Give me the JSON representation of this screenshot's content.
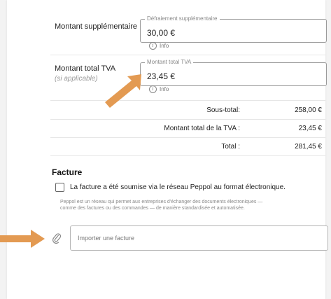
{
  "supplement": {
    "label": "Montant supplémentaire",
    "legend": "Défraiement supplémentaire",
    "value": "30,00 €",
    "info": "Info"
  },
  "vat": {
    "label": "Montant total TVA",
    "sublabel": "(si applicable)",
    "legend": "Montant total TVA",
    "value": "23,45 €",
    "info": "Info"
  },
  "totals": [
    {
      "label": "Sous-total:",
      "value": "258,00 €"
    },
    {
      "label": "Montant total de la TVA :",
      "value": "23,45 €"
    },
    {
      "label": "Total :",
      "value": "281,45 €"
    }
  ],
  "invoice": {
    "title": "Facture",
    "checkbox_label": "La facture a été soumise via le réseau Peppol au format électronique.",
    "checkbox_checked": false,
    "help_line1": "Peppol est un réseau qui permet aux entreprises d'échanger des documents électroniques —",
    "help_line2": "comme des factures ou des commandes — de manière standardisée et automatisée.",
    "upload_placeholder": "Importer une facture"
  },
  "colors": {
    "arrow": "#e39a52",
    "border": "#9a9a9a"
  },
  "icons": {
    "info": "info-icon",
    "attach": "paperclip-icon",
    "arrow": "arrow-icon"
  }
}
